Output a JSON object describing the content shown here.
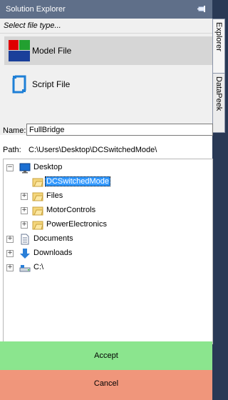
{
  "window": {
    "title": "Solution Explorer",
    "pin_icon": "pin-icon"
  },
  "side_tabs": [
    {
      "label": "Explorer",
      "active": true
    },
    {
      "label": "DataPeek",
      "active": false
    }
  ],
  "file_type": {
    "header": "Select file type...",
    "items": [
      {
        "label": "Model File",
        "icon": "model-file-icon",
        "selected": true
      },
      {
        "label": "Script File",
        "icon": "script-file-icon",
        "selected": false
      }
    ]
  },
  "name": {
    "label": "Name:",
    "value": "FullBridge"
  },
  "path": {
    "label": "Path:",
    "value": "C:\\Users\\Desktop\\DCSwitchedMode\\"
  },
  "tree": {
    "desktop": "Desktop",
    "dcswitchedmode": "DCSwitchedMode",
    "files": "Files",
    "motorcontrols": "MotorControls",
    "powerelectronics": "PowerElectronics",
    "documents": "Documents",
    "downloads": "Downloads",
    "drive_c": "C:\\"
  },
  "buttons": {
    "accept": "Accept",
    "cancel": "Cancel"
  },
  "colors": {
    "accept_bg": "#8be58e",
    "cancel_bg": "#f0967b",
    "selection": "#3399ff"
  }
}
